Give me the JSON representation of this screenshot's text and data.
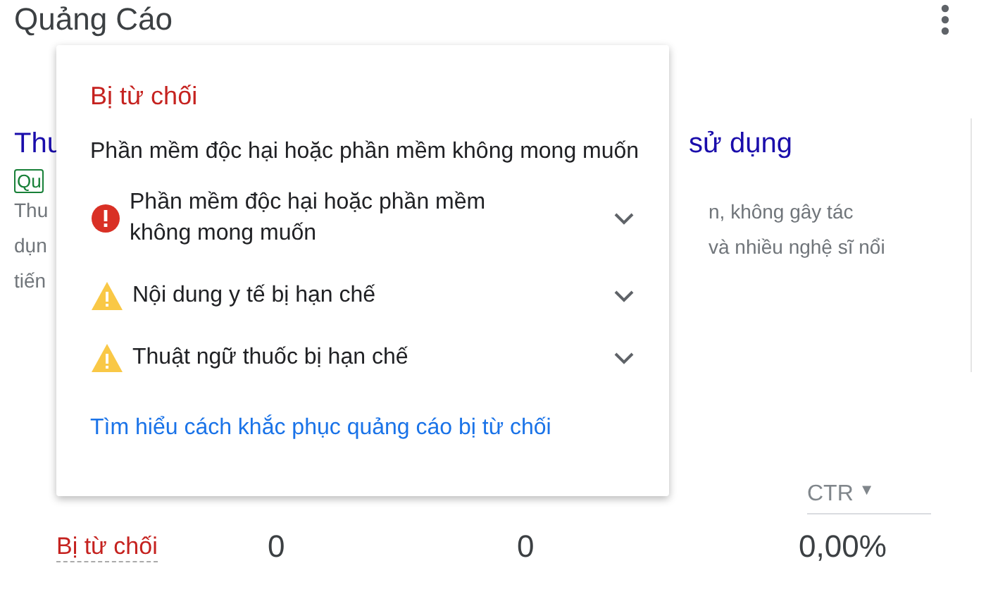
{
  "header": {
    "title": "Quảng Cáo"
  },
  "ad_card": {
    "left_fragments": {
      "title": "Thu",
      "badge": "Qu",
      "description_lines": [
        "Thu",
        "dụn",
        "tiến"
      ]
    },
    "right_fragments": {
      "title": "sử dụng",
      "description_lines": [
        "n, không gây tác",
        "và nhiều nghệ sĩ nổi"
      ]
    }
  },
  "stats": {
    "column_header": "CTR",
    "sort_icon": "▼",
    "row": {
      "status": "Bị từ chối",
      "values": [
        "0",
        "0",
        "0,00%"
      ]
    }
  },
  "popup": {
    "title": "Bị từ chối",
    "summary": "Phần mềm độc hại hoặc phần mềm không mong muốn",
    "issues": [
      {
        "kind": "error",
        "label": "Phần mềm độc hại hoặc phần mềm không mong muốn",
        "expanded": false
      },
      {
        "kind": "warning",
        "label": "Nội dung y tế bị hạn chế",
        "expanded": false
      },
      {
        "kind": "warning",
        "label": "Thuật ngữ thuốc bị hạn chế",
        "expanded": false
      }
    ],
    "link": "Tìm hiểu cách khắc phục quảng cáo bị từ chối"
  }
}
